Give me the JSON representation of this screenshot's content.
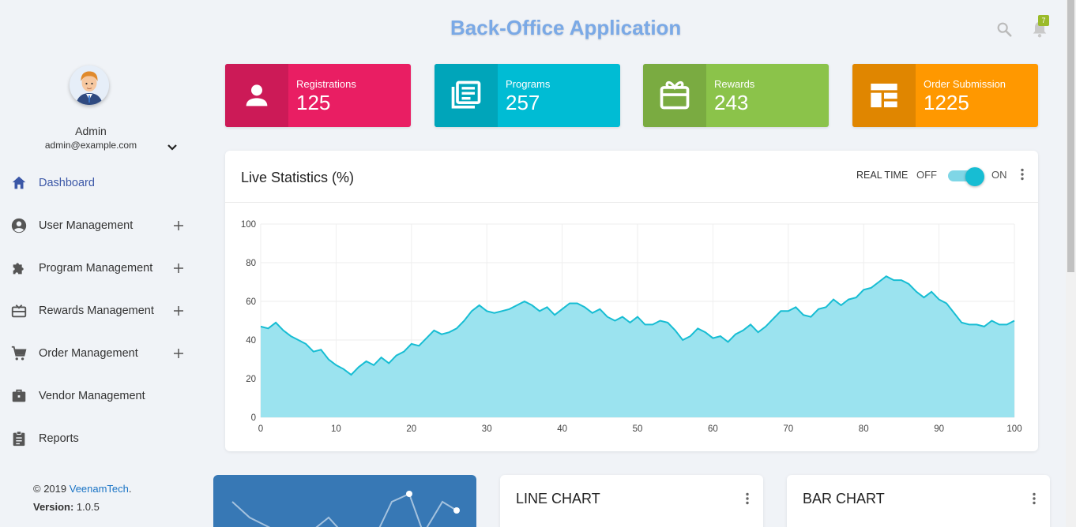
{
  "header": {
    "title": "Back-Office Application",
    "notification_count": "7",
    "icons": [
      "search-icon",
      "bell-icon"
    ]
  },
  "user": {
    "name": "Admin",
    "email": "admin@example.com"
  },
  "sidebar": {
    "items": [
      {
        "label": "Dashboard",
        "icon": "home-icon",
        "active": true
      },
      {
        "label": "User Management",
        "icon": "account-circle-icon",
        "expandable": true
      },
      {
        "label": "Program Management",
        "icon": "puzzle-icon",
        "expandable": true
      },
      {
        "label": "Rewards Management",
        "icon": "card-giftcard-icon",
        "expandable": true
      },
      {
        "label": "Order Management",
        "icon": "cart-icon",
        "expandable": true
      },
      {
        "label": "Vendor Management",
        "icon": "briefcase-icon"
      },
      {
        "label": "Reports",
        "icon": "clipboard-icon"
      }
    ],
    "footer": {
      "copyright_prefix": "© 2019 ",
      "company": "VeenamTech",
      "copyright_suffix": ".",
      "version_label": "Version:",
      "version": "1.0.5"
    }
  },
  "stats": [
    {
      "label": "Registrations",
      "value": "125",
      "color": "#e91e63",
      "icon_bg": "#cc1a57",
      "icon": "person-icon"
    },
    {
      "label": "Programs",
      "value": "257",
      "color": "#00bcd4",
      "icon_bg": "#00a5ba",
      "icon": "newspaper-icon"
    },
    {
      "label": "Rewards",
      "value": "243",
      "color": "#8bc34a",
      "icon_bg": "#7aab41",
      "icon": "gift-card-icon"
    },
    {
      "label": "Order Submission",
      "value": "1225",
      "color": "#ff9800",
      "icon_bg": "#e08600",
      "icon": "dashboard-layout-icon"
    }
  ],
  "live_stats": {
    "title": "Live Statistics (%)",
    "realtime_label": "REAL TIME",
    "off_label": "OFF",
    "on_label": "ON",
    "toggle_on": true
  },
  "chart_data": {
    "type": "area",
    "title": "",
    "xlabel": "",
    "ylabel": "",
    "xlim": [
      0,
      100
    ],
    "ylim": [
      0,
      100
    ],
    "x_ticks": [
      0,
      10,
      20,
      30,
      40,
      50,
      60,
      70,
      80,
      90,
      100
    ],
    "y_ticks": [
      0,
      20,
      40,
      60,
      80,
      100
    ],
    "grid": true,
    "line_color": "#17bdd3",
    "fill_color": "#9be3ef",
    "x": [
      0,
      1,
      2,
      3,
      4,
      5,
      6,
      7,
      8,
      9,
      10,
      11,
      12,
      13,
      14,
      15,
      16,
      17,
      18,
      19,
      20,
      21,
      22,
      23,
      24,
      25,
      26,
      27,
      28,
      29,
      30,
      31,
      32,
      33,
      34,
      35,
      36,
      37,
      38,
      39,
      40,
      41,
      42,
      43,
      44,
      45,
      46,
      47,
      48,
      49,
      50,
      51,
      52,
      53,
      54,
      55,
      56,
      57,
      58,
      59,
      60,
      61,
      62,
      63,
      64,
      65,
      66,
      67,
      68,
      69,
      70,
      71,
      72,
      73,
      74,
      75,
      76,
      77,
      78,
      79,
      80,
      81,
      82,
      83,
      84,
      85,
      86,
      87,
      88,
      89,
      90,
      91,
      92,
      93,
      94,
      95,
      96,
      97,
      98,
      99,
      100
    ],
    "values": [
      47,
      46,
      49,
      45,
      42,
      40,
      38,
      34,
      35,
      30,
      27,
      25,
      22,
      26,
      29,
      27,
      31,
      28,
      32,
      34,
      38,
      37,
      41,
      45,
      43,
      44,
      46,
      50,
      55,
      58,
      55,
      54,
      55,
      56,
      58,
      60,
      58,
      55,
      57,
      53,
      56,
      59,
      59,
      57,
      54,
      56,
      52,
      50,
      52,
      49,
      52,
      48,
      48,
      50,
      49,
      45,
      40,
      42,
      46,
      44,
      41,
      42,
      39,
      43,
      45,
      48,
      44,
      47,
      51,
      55,
      55,
      57,
      53,
      52,
      56,
      57,
      61,
      58,
      61,
      62,
      66,
      67,
      70,
      73,
      71,
      71,
      69,
      65,
      62,
      65,
      61,
      59,
      54,
      49,
      48,
      48,
      47,
      50,
      48,
      48,
      50
    ]
  },
  "bottom_cards": [
    {
      "title": ""
    },
    {
      "title": "LINE CHART"
    },
    {
      "title": "BAR CHART"
    }
  ]
}
